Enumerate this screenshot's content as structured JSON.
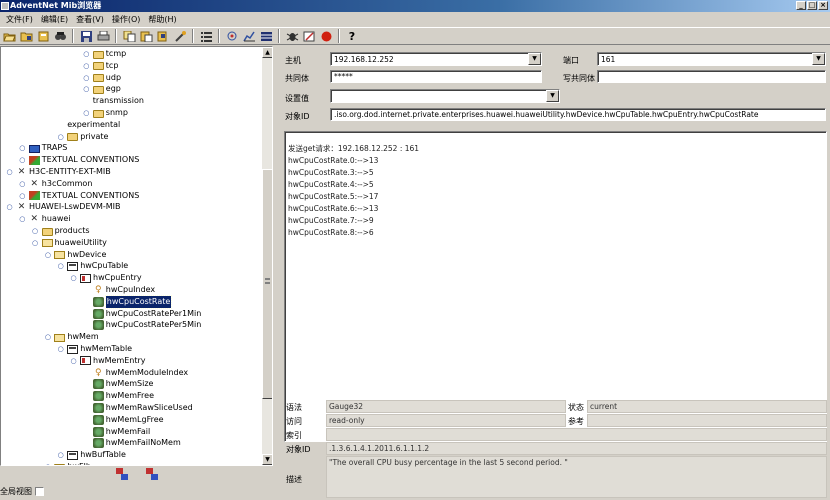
{
  "window": {
    "title": "AdventNet Mib浏览器",
    "btn_min": "_",
    "btn_max": "□",
    "btn_close": "×"
  },
  "menu": [
    "文件(F)",
    "编辑(E)",
    "查看(V)",
    "操作(O)",
    "帮助(H)"
  ],
  "toolbar": {
    "icons": [
      "open-folder-icon",
      "save-folder-icon",
      "load-mib-icon",
      "find-icon",
      "save-icon",
      "print-icon",
      "copy-icon",
      "paste-icon",
      "edit-icon",
      "wand-icon",
      "list-icon",
      "network-icon",
      "graph-icon",
      "table-icon",
      "debug-icon",
      "notepad-icon",
      "stop-icon",
      "help-icon"
    ],
    "help_label": "?"
  },
  "tree": [
    {
      "label": "tcmp",
      "depth": 6,
      "icon": "folder",
      "handle": "o-"
    },
    {
      "label": "tcp",
      "depth": 6,
      "icon": "folder",
      "handle": "o-"
    },
    {
      "label": "udp",
      "depth": 6,
      "icon": "folder",
      "handle": "o-"
    },
    {
      "label": "egp",
      "depth": 6,
      "icon": "folder",
      "handle": "o-"
    },
    {
      "label": "transmission",
      "depth": 6,
      "icon": "none",
      "handle": ""
    },
    {
      "label": "snmp",
      "depth": 6,
      "icon": "folder",
      "handle": "o-"
    },
    {
      "label": "experimental",
      "depth": 4,
      "icon": "none",
      "handle": ""
    },
    {
      "label": "private",
      "depth": 4,
      "icon": "folder",
      "handle": "o-"
    },
    {
      "label": "TRAPS",
      "depth": 1,
      "icon": "traps",
      "handle": "o-"
    },
    {
      "label": "TEXTUAL CONVENTIONS",
      "depth": 1,
      "icon": "tc",
      "handle": "o-"
    },
    {
      "label": "H3C-ENTITY-EXT-MIB",
      "depth": 0,
      "icon": "mib",
      "handle": "o-"
    },
    {
      "label": "h3cCommon",
      "depth": 1,
      "icon": "mib",
      "handle": "o-"
    },
    {
      "label": "TEXTUAL CONVENTIONS",
      "depth": 1,
      "icon": "tc",
      "handle": "o-"
    },
    {
      "label": "HUAWEI-LswDEVM-MIB",
      "depth": 0,
      "icon": "mib",
      "handle": "o-"
    },
    {
      "label": "huawei",
      "depth": 1,
      "icon": "mib",
      "handle": "o-"
    },
    {
      "label": "products",
      "depth": 2,
      "icon": "folder",
      "handle": "o-"
    },
    {
      "label": "huaweiUtility",
      "depth": 2,
      "icon": "folder-open",
      "handle": "o-"
    },
    {
      "label": "hwDevice",
      "depth": 3,
      "icon": "folder-open",
      "handle": "o-"
    },
    {
      "label": "hwCpuTable",
      "depth": 4,
      "icon": "table",
      "handle": "o-"
    },
    {
      "label": "hwCpuEntry",
      "depth": 5,
      "icon": "entry",
      "handle": "o-"
    },
    {
      "label": "hwCpuIndex",
      "depth": 6,
      "icon": "key",
      "handle": ""
    },
    {
      "label": "hwCpuCostRate",
      "depth": 6,
      "icon": "leaf",
      "handle": "",
      "selected": true
    },
    {
      "label": "hwCpuCostRatePer1Min",
      "depth": 6,
      "icon": "leaf",
      "handle": ""
    },
    {
      "label": "hwCpuCostRatePer5Min",
      "depth": 6,
      "icon": "leaf",
      "handle": ""
    },
    {
      "label": "hwMem",
      "depth": 3,
      "icon": "folder-open",
      "handle": "o-"
    },
    {
      "label": "hwMemTable",
      "depth": 4,
      "icon": "table",
      "handle": "o-"
    },
    {
      "label": "hwMemEntry",
      "depth": 5,
      "icon": "entry",
      "handle": "o-"
    },
    {
      "label": "hwMemModuleIndex",
      "depth": 6,
      "icon": "key",
      "handle": ""
    },
    {
      "label": "hwMemSize",
      "depth": 6,
      "icon": "leaf",
      "handle": ""
    },
    {
      "label": "hwMemFree",
      "depth": 6,
      "icon": "leaf",
      "handle": ""
    },
    {
      "label": "hwMemRawSliceUsed",
      "depth": 6,
      "icon": "leaf",
      "handle": ""
    },
    {
      "label": "hwMemLgFree",
      "depth": 6,
      "icon": "leaf",
      "handle": ""
    },
    {
      "label": "hwMemFail",
      "depth": 6,
      "icon": "leaf",
      "handle": ""
    },
    {
      "label": "hwMemFailNoMem",
      "depth": 6,
      "icon": "leaf",
      "handle": ""
    },
    {
      "label": "hwBufTable",
      "depth": 4,
      "icon": "table",
      "handle": "o-"
    },
    {
      "label": "hwFlh",
      "depth": 3,
      "icon": "folder",
      "handle": "o-"
    }
  ],
  "left_footer": {
    "global_view": "全局视图"
  },
  "form": {
    "host_label": "主机",
    "host_value": "192.168.12.252",
    "port_label": "端口",
    "port_value": "161",
    "community_label": "共同体",
    "community_value": "*****",
    "write_community_label": "写共同体",
    "write_community_value": "",
    "set_value_label": "设置值",
    "set_value_value": "",
    "oid_label": "对象ID",
    "oid_value": ".iso.org.dod.internet.private.enterprises.huawei.huaweiUtility.hwDevice.hwCpuTable.hwCpuEntry.hwCpuCostRate"
  },
  "result_lines": [
    "发送get请求：192.168.12.252 : 161",
    "hwCpuCostRate.0:-->13",
    "hwCpuCostRate.3:-->5",
    "hwCpuCostRate.4:-->5",
    "hwCpuCostRate.5:-->17",
    "hwCpuCostRate.6:-->13",
    "hwCpuCostRate.7:-->9",
    "hwCpuCostRate.8:-->6"
  ],
  "info": {
    "syntax_label": "语法",
    "syntax_value": "Gauge32",
    "status_label": "状态",
    "status_value": "current",
    "access_label": "访问",
    "access_value": "read-only",
    "reference_label": "参考",
    "reference_value": "",
    "index_label": "索引",
    "index_value": "",
    "oid_label": "对象ID",
    "oid_value": ".1.3.6.1.4.1.2011.6.1.1.1.2",
    "description_label": "描述",
    "description_value": "\"The overall CPU busy percentage in the last 5 second period. \""
  }
}
